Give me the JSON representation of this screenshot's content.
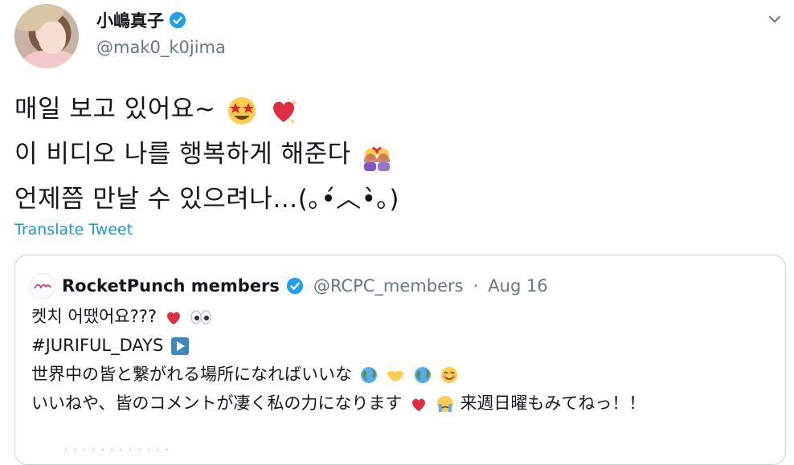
{
  "author": {
    "display_name": "小嶋真子",
    "handle": "@mak0_k0jima"
  },
  "tweet": {
    "lines": [
      "매일 보고 있어요~",
      "이 비디오 나를 행복하게 해준다",
      "언제쯤 만날 수 있으려나…(｡•́︿•̀｡)"
    ],
    "translate_label": "Translate Tweet"
  },
  "quoted_tweet": {
    "display_name": "RocketPunch members",
    "handle": "@RCPC_members",
    "separator": "·",
    "date": "Aug 16",
    "lines": [
      "켓치 어땠어요???",
      "#JURIFUL_DAYS",
      "世界中の皆と繋がれる場所になればいいな",
      "いいねや、皆のコメントが凄く私の力になります",
      "来週日曜もみてねっ！！"
    ]
  },
  "icons": {
    "verified": "verified-badge-icon",
    "chevron": "chevron-down-icon"
  },
  "colors": {
    "link": "#1b95e0",
    "secondary_text": "#657786",
    "verified": "#1da1f2",
    "border": "#ccd6dd"
  }
}
